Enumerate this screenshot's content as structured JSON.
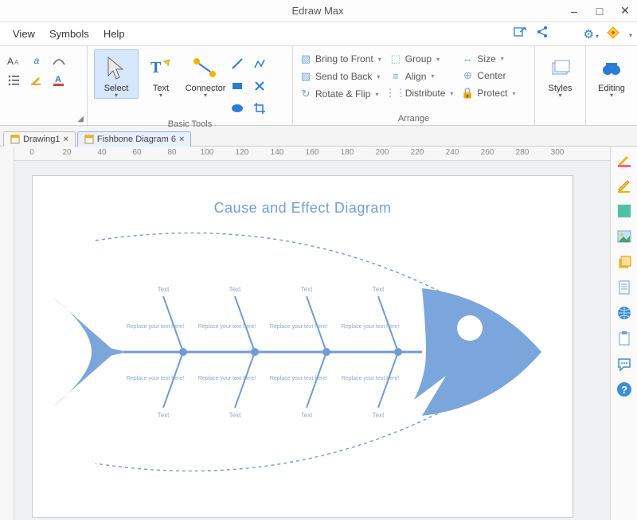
{
  "titlebar": {
    "app_name": "Edraw Max"
  },
  "window": {
    "minimize": "–",
    "maximize": "□",
    "close": "✕"
  },
  "menu": {
    "view": "View",
    "symbols": "Symbols",
    "help": "Help"
  },
  "ribbon": {
    "select": "Select",
    "text": "Text",
    "connector": "Connector",
    "basic_tools_caption": "Basic Tools",
    "arrange": {
      "bring_to_front": "Bring to Front",
      "send_to_back": "Send to Back",
      "rotate_flip": "Rotate & Flip",
      "group": "Group",
      "align": "Align",
      "distribute": "Distribute",
      "size": "Size",
      "center": "Center",
      "protect": "Protect",
      "caption": "Arrange"
    },
    "styles": "Styles",
    "editing": "Editing"
  },
  "tabs": {
    "tab1": "Drawing1",
    "tab2": "Fishbone Diagram 6"
  },
  "ruler": {
    "t0": "0",
    "t20": "20",
    "t40": "40",
    "t60": "60",
    "t80": "80",
    "t100": "100",
    "t120": "120",
    "t140": "140",
    "t160": "160",
    "t180": "180",
    "t200": "200",
    "t220": "220",
    "t240": "240",
    "t260": "260",
    "t280": "280",
    "t300": "300"
  },
  "diagram": {
    "title": "Cause and Effect Diagram",
    "bone_label": "Text",
    "cause_label": "Replace your text here!"
  }
}
